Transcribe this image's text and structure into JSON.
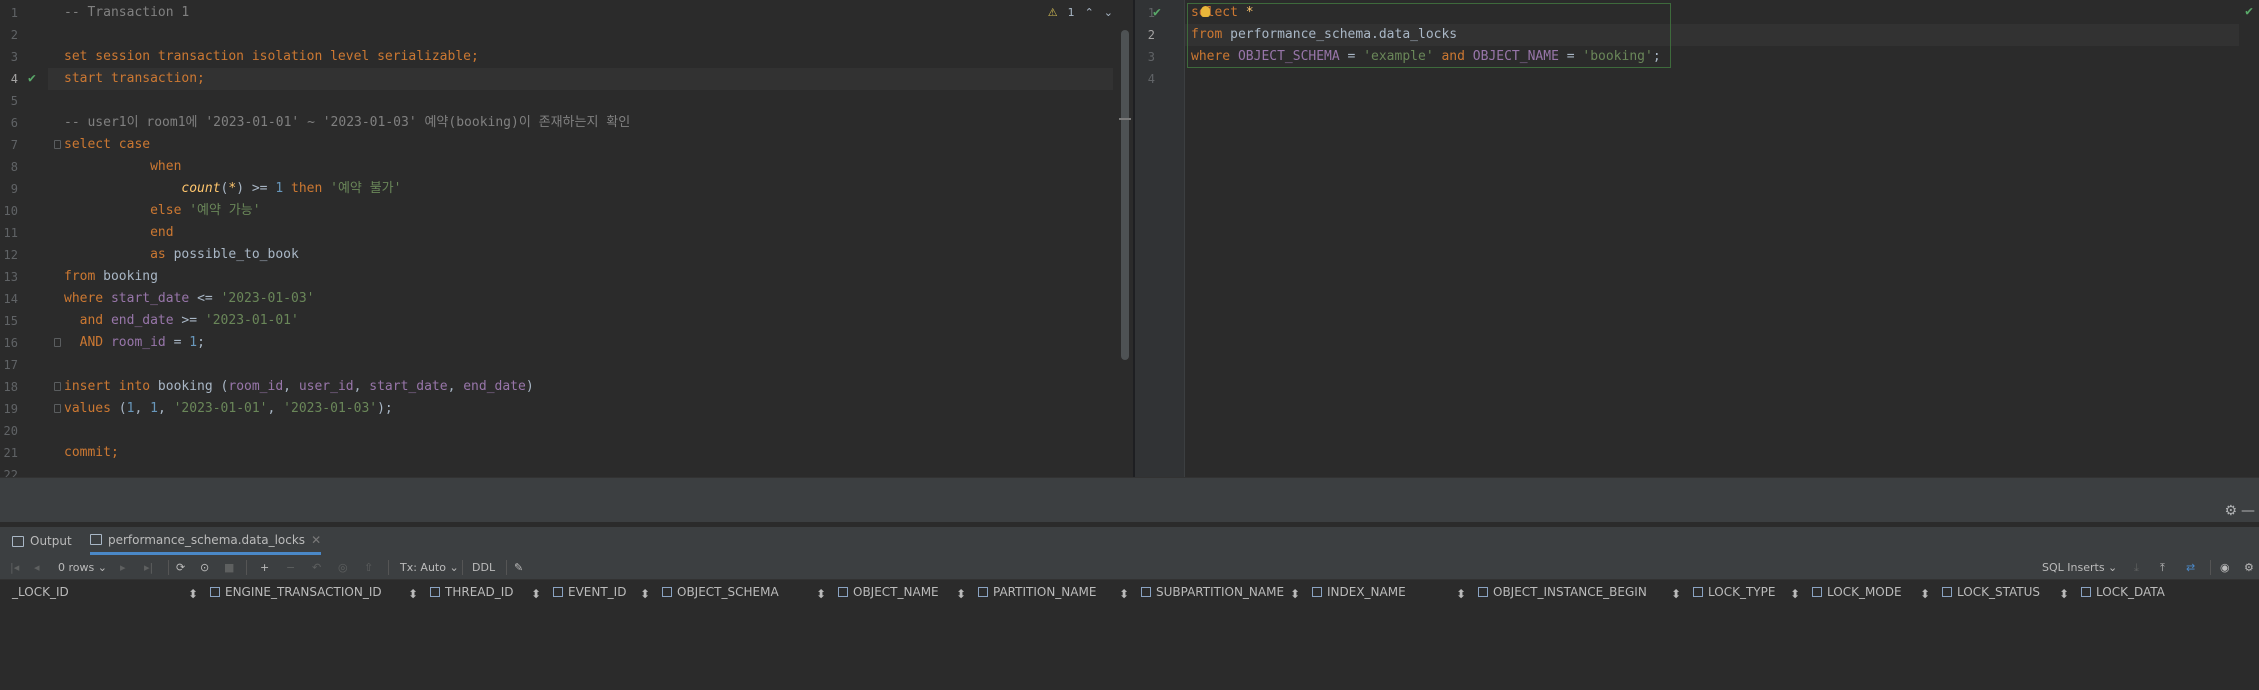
{
  "left_editor": {
    "inspection_count": "1",
    "lines": [
      {
        "n": "1",
        "tokens": [
          [
            "cm",
            "-- Transaction 1"
          ]
        ]
      },
      {
        "n": "2",
        "tokens": []
      },
      {
        "n": "3",
        "tokens": [
          [
            "kw",
            "set session transaction isolation level serializable;"
          ]
        ]
      },
      {
        "n": "4",
        "tokens": [
          [
            "kw",
            "start transaction;"
          ]
        ],
        "current": true,
        "check": true
      },
      {
        "n": "5",
        "tokens": []
      },
      {
        "n": "6",
        "tokens": [
          [
            "cm",
            "-- user1이 room1에 '2023-01-01' ~ '2023-01-03' 예약(booking)이 존재하는지 확인"
          ]
        ]
      },
      {
        "n": "7",
        "tokens": [
          [
            "kw",
            "select "
          ],
          [
            "kw",
            "case"
          ]
        ]
      },
      {
        "n": "8",
        "tokens": [
          [
            "plain",
            "           "
          ],
          [
            "kw",
            "when"
          ]
        ]
      },
      {
        "n": "9",
        "tokens": [
          [
            "plain",
            "               "
          ],
          [
            "fn",
            "count"
          ],
          [
            "plain",
            "("
          ],
          [
            "fn",
            "*"
          ],
          [
            "plain",
            ") >= "
          ],
          [
            "num",
            "1"
          ],
          [
            "kw",
            " then "
          ],
          [
            "str",
            "'예약 불가'"
          ]
        ]
      },
      {
        "n": "10",
        "tokens": [
          [
            "plain",
            "           "
          ],
          [
            "kw",
            "else "
          ],
          [
            "str",
            "'예약 가능'"
          ]
        ]
      },
      {
        "n": "11",
        "tokens": [
          [
            "plain",
            "           "
          ],
          [
            "kw",
            "end"
          ]
        ]
      },
      {
        "n": "12",
        "tokens": [
          [
            "plain",
            "           "
          ],
          [
            "kw",
            "as "
          ],
          [
            "plain",
            "possible_to_book"
          ]
        ]
      },
      {
        "n": "13",
        "tokens": [
          [
            "kw",
            "from "
          ],
          [
            "tbl",
            "booking"
          ]
        ]
      },
      {
        "n": "14",
        "tokens": [
          [
            "kw",
            "where "
          ],
          [
            "col",
            "start_date"
          ],
          [
            "plain",
            " <= "
          ],
          [
            "str",
            "'2023-01-03'"
          ]
        ]
      },
      {
        "n": "15",
        "tokens": [
          [
            "kw",
            "  and "
          ],
          [
            "col",
            "end_date"
          ],
          [
            "plain",
            " >= "
          ],
          [
            "str",
            "'2023-01-01'"
          ]
        ]
      },
      {
        "n": "16",
        "tokens": [
          [
            "kw",
            "  AND "
          ],
          [
            "col",
            "room_id"
          ],
          [
            "plain",
            " = "
          ],
          [
            "num",
            "1"
          ],
          [
            "plain",
            ";"
          ]
        ]
      },
      {
        "n": "17",
        "tokens": []
      },
      {
        "n": "18",
        "tokens": [
          [
            "kw",
            "insert into "
          ],
          [
            "tbl",
            "booking"
          ],
          [
            "plain",
            " ("
          ],
          [
            "col",
            "room_id"
          ],
          [
            "plain",
            ", "
          ],
          [
            "col",
            "user_id"
          ],
          [
            "plain",
            ", "
          ],
          [
            "col",
            "start_date"
          ],
          [
            "plain",
            ", "
          ],
          [
            "col",
            "end_date"
          ],
          [
            "plain",
            ")"
          ]
        ]
      },
      {
        "n": "19",
        "tokens": [
          [
            "kw",
            "values "
          ],
          [
            "plain",
            "("
          ],
          [
            "num",
            "1"
          ],
          [
            "plain",
            ", "
          ],
          [
            "num",
            "1"
          ],
          [
            "plain",
            ", "
          ],
          [
            "str",
            "'2023-01-01'"
          ],
          [
            "plain",
            ", "
          ],
          [
            "str",
            "'2023-01-03'"
          ],
          [
            "plain",
            ");"
          ]
        ]
      },
      {
        "n": "20",
        "tokens": []
      },
      {
        "n": "21",
        "tokens": [
          [
            "kw",
            "commit;"
          ]
        ]
      },
      {
        "n": "22",
        "tokens": []
      }
    ]
  },
  "right_editor": {
    "lines": [
      {
        "n": "1",
        "tokens": [
          [
            "kw",
            "select "
          ],
          [
            "fn",
            "*"
          ]
        ],
        "check": true
      },
      {
        "n": "2",
        "tokens": [
          [
            "kw",
            "from "
          ],
          [
            "tbl",
            "performance_schema"
          ],
          [
            "plain",
            "."
          ],
          [
            "tbl",
            "data_locks"
          ]
        ],
        "current": true
      },
      {
        "n": "3",
        "tokens": [
          [
            "kw",
            "where "
          ],
          [
            "col",
            "OBJECT_SCHEMA"
          ],
          [
            "plain",
            " = "
          ],
          [
            "str",
            "'example'"
          ],
          [
            "kw",
            " and "
          ],
          [
            "col",
            "OBJECT_NAME"
          ],
          [
            "plain",
            " = "
          ],
          [
            "str",
            "'booking'"
          ],
          [
            "plain",
            ";"
          ]
        ]
      },
      {
        "n": "4",
        "tokens": []
      }
    ]
  },
  "bottom": {
    "tabs": [
      {
        "label": "Output",
        "active": false
      },
      {
        "label": "performance_schema.data_locks",
        "active": true
      }
    ],
    "toolbar": {
      "rows": "0 rows",
      "tx": "Tx: Auto",
      "ddl": "DDL",
      "sql_mode": "SQL Inserts"
    },
    "columns": [
      "_LOCK_ID",
      "ENGINE_TRANSACTION_ID",
      "THREAD_ID",
      "EVENT_ID",
      "OBJECT_SCHEMA",
      "OBJECT_NAME",
      "PARTITION_NAME",
      "SUBPARTITION_NAME",
      "INDEX_NAME",
      "OBJECT_INSTANCE_BEGIN",
      "LOCK_TYPE",
      "LOCK_MODE",
      "LOCK_STATUS",
      "LOCK_DATA"
    ]
  },
  "icons": {
    "check": "check-icon",
    "warning": "warning-icon",
    "settings": "gear-icon",
    "minimize": "minimize-icon"
  },
  "colors": {
    "background": "#2b2b2b",
    "keyword": "#cc7832",
    "string": "#6a8759",
    "number": "#6897bb",
    "column": "#9876aa",
    "comment": "#808080",
    "active_tab_underline": "#4a88c7"
  }
}
